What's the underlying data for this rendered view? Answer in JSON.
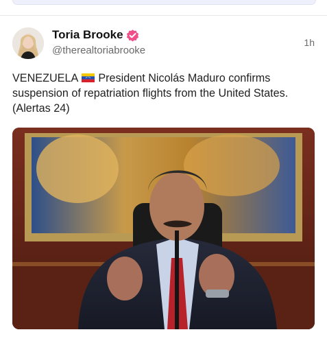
{
  "post": {
    "author_name": "Toria Brooke",
    "author_handle": "@therealtoriabrooke",
    "timestamp": "1h",
    "verified": true,
    "text_before_flag": "VENEZUELA ",
    "text_after_flag": " President Nicolás Maduro confirms suspension of repatriation flights from the United States. (Alertas 24)",
    "flag_icon": "venezuela-flag-icon",
    "media_icon": "photo"
  },
  "colors": {
    "verified_badge": "#f0508a",
    "handle": "#6a6a6a",
    "divider": "#e6e6e6"
  }
}
